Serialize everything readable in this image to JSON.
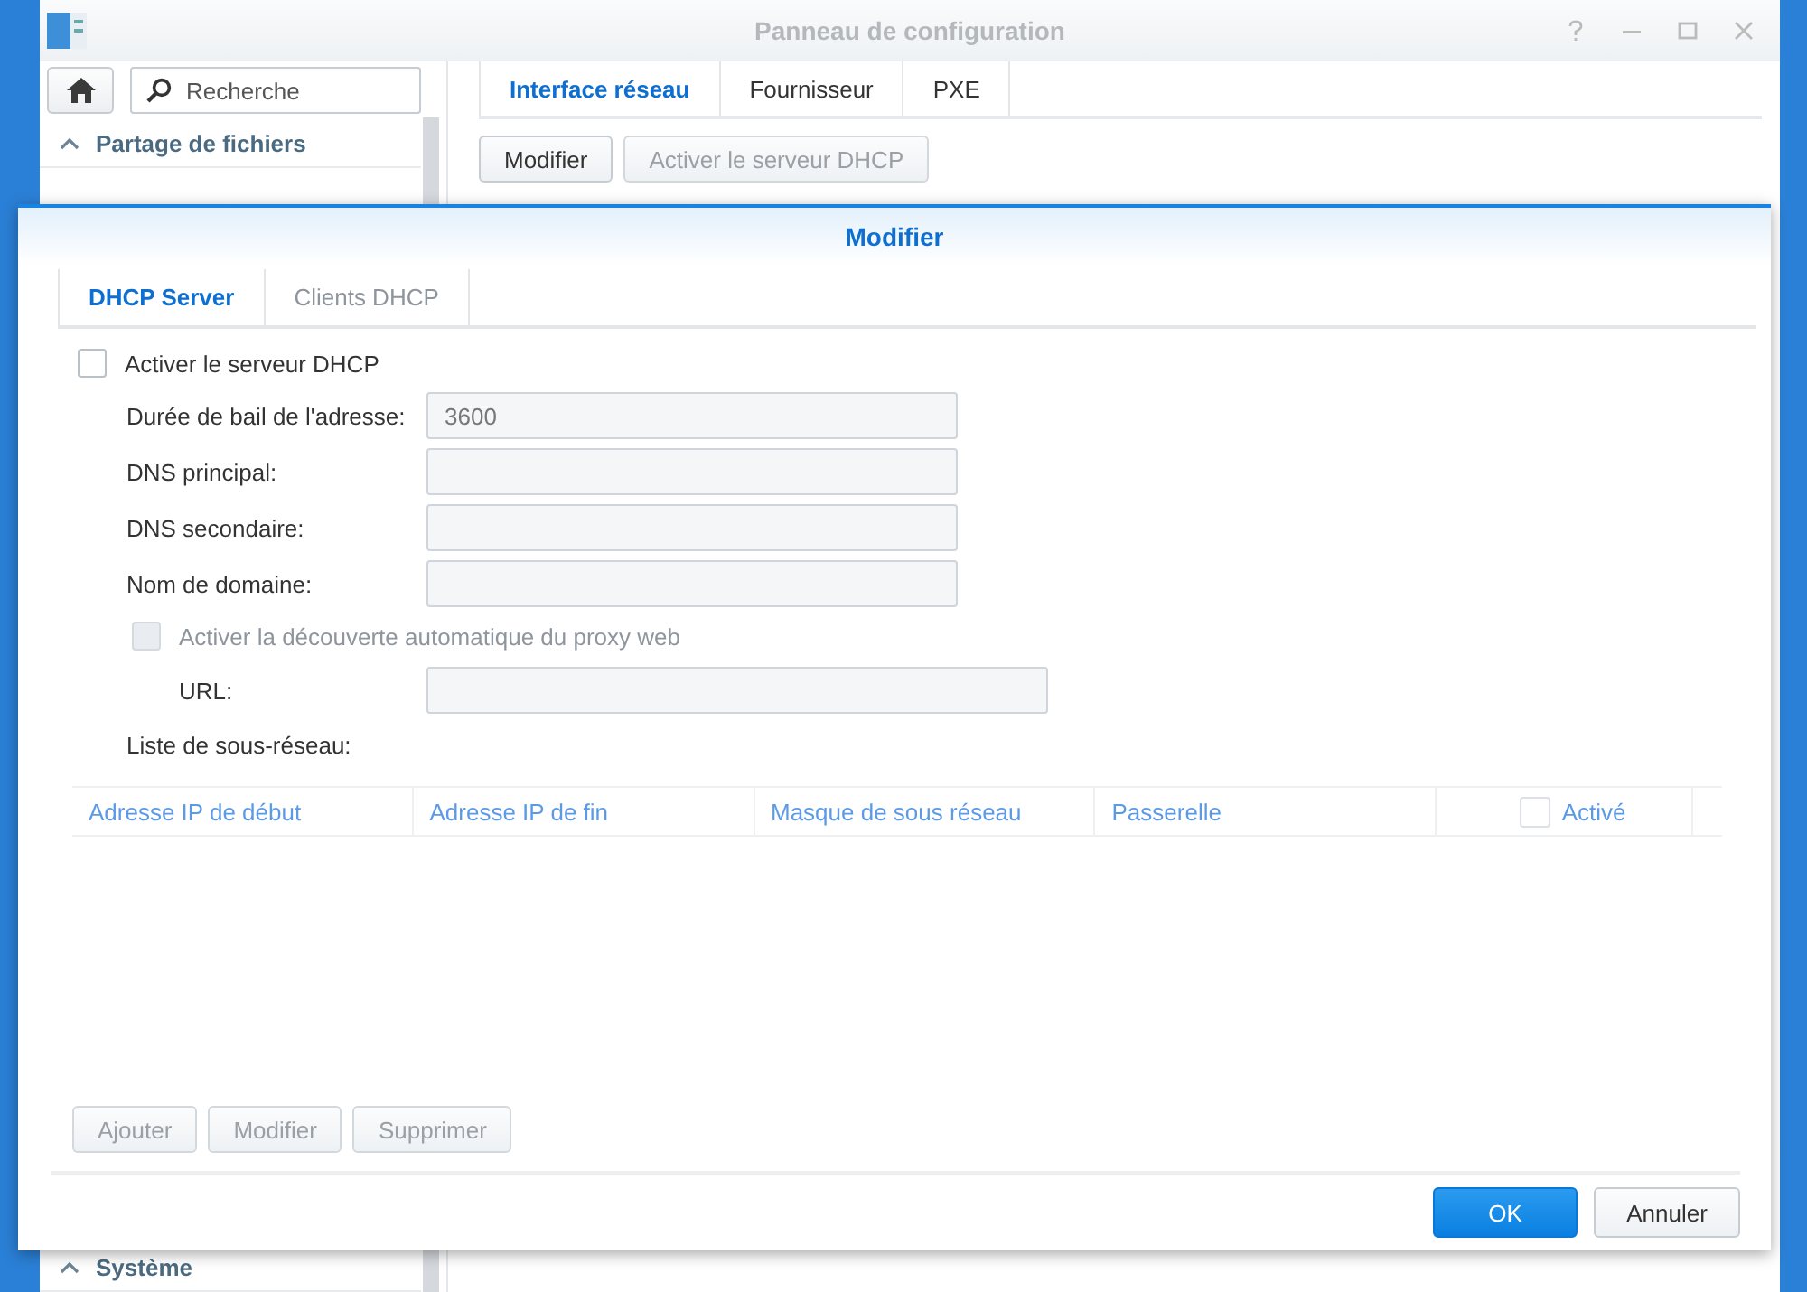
{
  "window": {
    "title": "Panneau de configuration"
  },
  "sidebar": {
    "search": {
      "placeholder": "Recherche"
    },
    "items": [
      {
        "label": "Partage de fichiers",
        "expanded": true
      },
      {
        "label": "Système",
        "expanded": true
      }
    ]
  },
  "tabs": [
    {
      "label": "Interface réseau",
      "selected": true
    },
    {
      "label": "Fournisseur",
      "selected": false
    },
    {
      "label": "PXE",
      "selected": false
    }
  ],
  "toolbar": [
    {
      "label": "Modifier",
      "disabled": false
    },
    {
      "label": "Activer le serveur DHCP",
      "disabled": true
    }
  ],
  "dialog": {
    "title": "Modifier",
    "tabs": [
      {
        "label": "DHCP Server",
        "selected": true
      },
      {
        "label": "Clients DHCP",
        "selected": false
      }
    ],
    "enable_dhcp": {
      "label": "Activer le serveur DHCP",
      "checked": false,
      "disabled": false
    },
    "fields": [
      {
        "label": "Durée de bail de l'adresse:",
        "value": "3600"
      },
      {
        "label": "DNS principal:"
      },
      {
        "label": "DNS secondaire:"
      },
      {
        "label": "Nom de domaine:"
      }
    ],
    "proxy": {
      "label": "Activer la découverte automatique du proxy web",
      "checked": false,
      "disabled": true
    },
    "url": {
      "label": "URL:"
    },
    "subnet_label": "Liste de sous-réseau:",
    "table": {
      "columns": [
        {
          "label": "Adresse IP de début",
          "kind": "text"
        },
        {
          "label": "Adresse IP de fin",
          "kind": "text"
        },
        {
          "label": "Masque de sous réseau",
          "kind": "text"
        },
        {
          "label": "Passerelle",
          "kind": "text"
        },
        {
          "label": "Activé",
          "kind": "checkbox",
          "checked": false
        }
      ]
    },
    "actions": [
      {
        "label": "Ajouter",
        "disabled": true
      },
      {
        "label": "Modifier",
        "disabled": true
      },
      {
        "label": "Supprimer",
        "disabled": true
      }
    ],
    "buttons": [
      {
        "label": "OK",
        "kind": "primary"
      },
      {
        "label": "Annuler",
        "kind": "default"
      }
    ]
  }
}
